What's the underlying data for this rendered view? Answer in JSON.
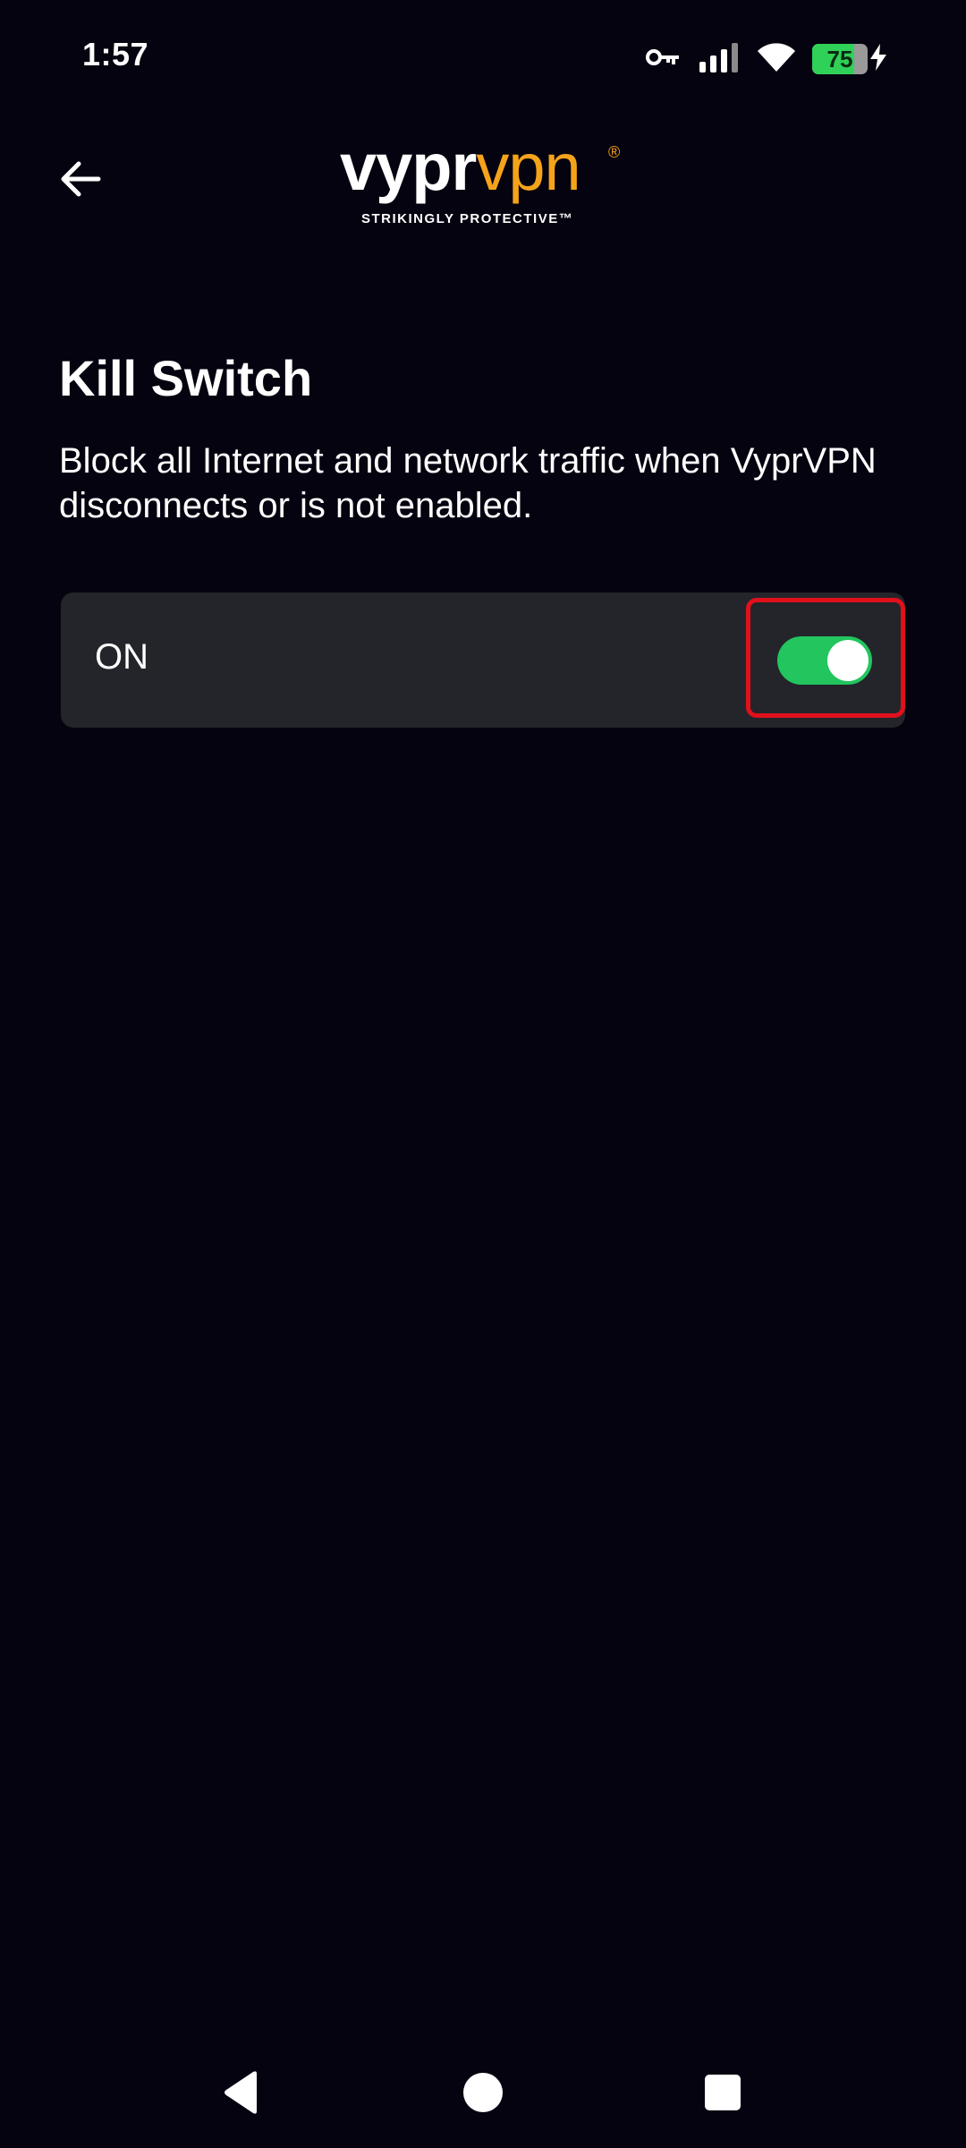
{
  "status_bar": {
    "time": "1:57",
    "battery_level": "75",
    "battery_fraction": 0.75,
    "icons": [
      "vpn-key-icon",
      "signal-icon",
      "wifi-icon",
      "battery-icon",
      "charging-bolt-icon"
    ]
  },
  "header": {
    "back_icon": "arrow-left-icon",
    "logo": {
      "part1": "vypr",
      "part2": "vpn",
      "registered": "®",
      "tagline": "STRIKINGLY PROTECTIVE™"
    }
  },
  "page": {
    "title": "Kill Switch",
    "description": "Block all Internet and network traffic when VyprVPN disconnects or is not enabled."
  },
  "kill_switch": {
    "label": "ON",
    "enabled": true
  },
  "nav_bar": {
    "icons": [
      "back-triangle-icon",
      "home-circle-icon",
      "recents-square-icon"
    ]
  },
  "colors": {
    "background": "#05030f",
    "card": "#23252a",
    "accent_orange": "#f5a31a",
    "toggle_on": "#22c55e",
    "highlight_red": "#e0101c",
    "battery_green": "#2fd159"
  }
}
